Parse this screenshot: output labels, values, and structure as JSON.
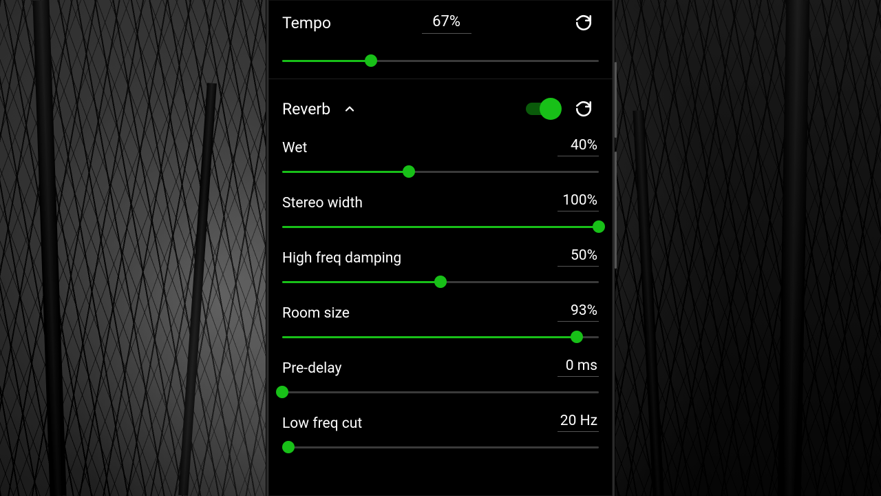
{
  "colors": {
    "accent": "#18c018"
  },
  "tempo": {
    "label": "Tempo",
    "value_text": "67%",
    "percent": 28
  },
  "reverb": {
    "title": "Reverb",
    "expanded": true,
    "enabled": true,
    "params": {
      "wet": {
        "label": "Wet",
        "value_text": "40%",
        "percent": 40
      },
      "stereo_width": {
        "label": "Stereo width",
        "value_text": "100%",
        "percent": 100
      },
      "hf_damping": {
        "label": "High freq damping",
        "value_text": "50%",
        "percent": 50
      },
      "room_size": {
        "label": "Room size",
        "value_text": "93%",
        "percent": 93
      },
      "pre_delay": {
        "label": "Pre-delay",
        "value_text": "0 ms",
        "percent": 0
      },
      "low_freq_cut": {
        "label": "Low freq cut",
        "value_text": "20 Hz",
        "percent": 2
      }
    }
  }
}
